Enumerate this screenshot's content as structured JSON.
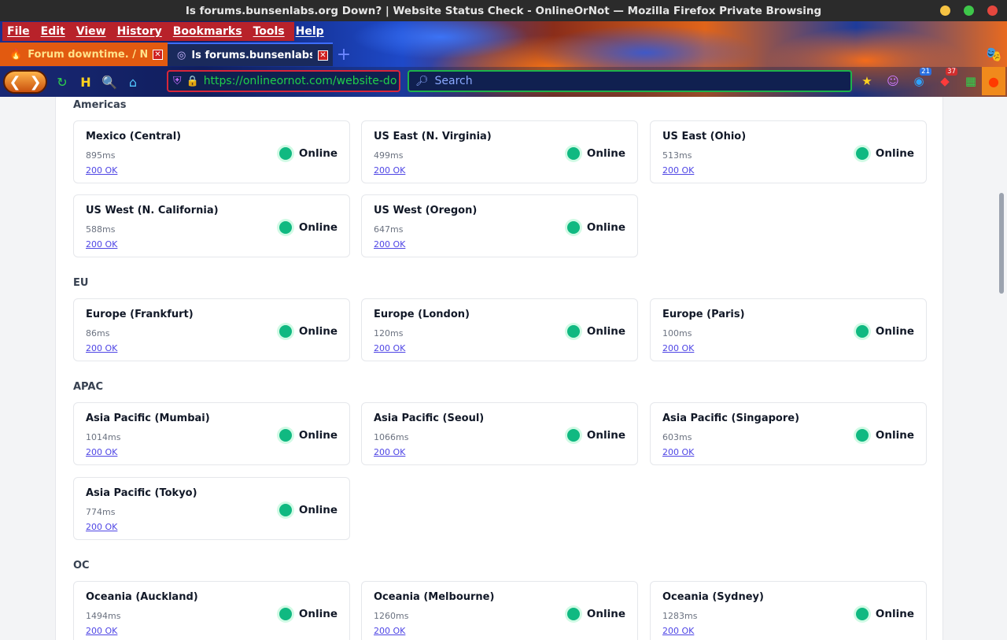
{
  "window": {
    "title": "Is forums.bunsenlabs.org Down? | Website Status Check - OnlineOrNot — Mozilla Firefox Private Browsing",
    "controls": [
      "#f6c343",
      "#3ec74a",
      "#e5473e"
    ]
  },
  "menu": [
    "File",
    "Edit",
    "View",
    "History",
    "Bookmarks",
    "Tools",
    "Help"
  ],
  "tabs": [
    {
      "title": "Forum downtime. / News",
      "active": false
    },
    {
      "title": "Is forums.bunsenlabs.org",
      "active": true
    }
  ],
  "urlbar": {
    "url": "https://onlineornot.com/website-do"
  },
  "search": {
    "placeholder": "Search"
  },
  "badges": {
    "a": "21",
    "b": "37"
  },
  "regions": [
    {
      "name": "Americas",
      "cards": [
        {
          "name": "Mexico (Central)",
          "ms": "895ms",
          "code": "200 OK",
          "status": "Online"
        },
        {
          "name": "US East (N. Virginia)",
          "ms": "499ms",
          "code": "200 OK",
          "status": "Online"
        },
        {
          "name": "US East (Ohio)",
          "ms": "513ms",
          "code": "200 OK",
          "status": "Online"
        },
        {
          "name": "US West (N. California)",
          "ms": "588ms",
          "code": "200 OK",
          "status": "Online"
        },
        {
          "name": "US West (Oregon)",
          "ms": "647ms",
          "code": "200 OK",
          "status": "Online"
        }
      ]
    },
    {
      "name": "EU",
      "cards": [
        {
          "name": "Europe (Frankfurt)",
          "ms": "86ms",
          "code": "200 OK",
          "status": "Online"
        },
        {
          "name": "Europe (London)",
          "ms": "120ms",
          "code": "200 OK",
          "status": "Online"
        },
        {
          "name": "Europe (Paris)",
          "ms": "100ms",
          "code": "200 OK",
          "status": "Online"
        }
      ]
    },
    {
      "name": "APAC",
      "cards": [
        {
          "name": "Asia Pacific (Mumbai)",
          "ms": "1014ms",
          "code": "200 OK",
          "status": "Online"
        },
        {
          "name": "Asia Pacific (Seoul)",
          "ms": "1066ms",
          "code": "200 OK",
          "status": "Online"
        },
        {
          "name": "Asia Pacific (Singapore)",
          "ms": "603ms",
          "code": "200 OK",
          "status": "Online"
        },
        {
          "name": "Asia Pacific (Tokyo)",
          "ms": "774ms",
          "code": "200 OK",
          "status": "Online"
        }
      ]
    },
    {
      "name": "OC",
      "cards": [
        {
          "name": "Oceania (Auckland)",
          "ms": "1494ms",
          "code": "200 OK",
          "status": "Online"
        },
        {
          "name": "Oceania (Melbourne)",
          "ms": "1260ms",
          "code": "200 OK",
          "status": "Online"
        },
        {
          "name": "Oceania (Sydney)",
          "ms": "1283ms",
          "code": "200 OK",
          "status": "Online"
        }
      ]
    }
  ]
}
